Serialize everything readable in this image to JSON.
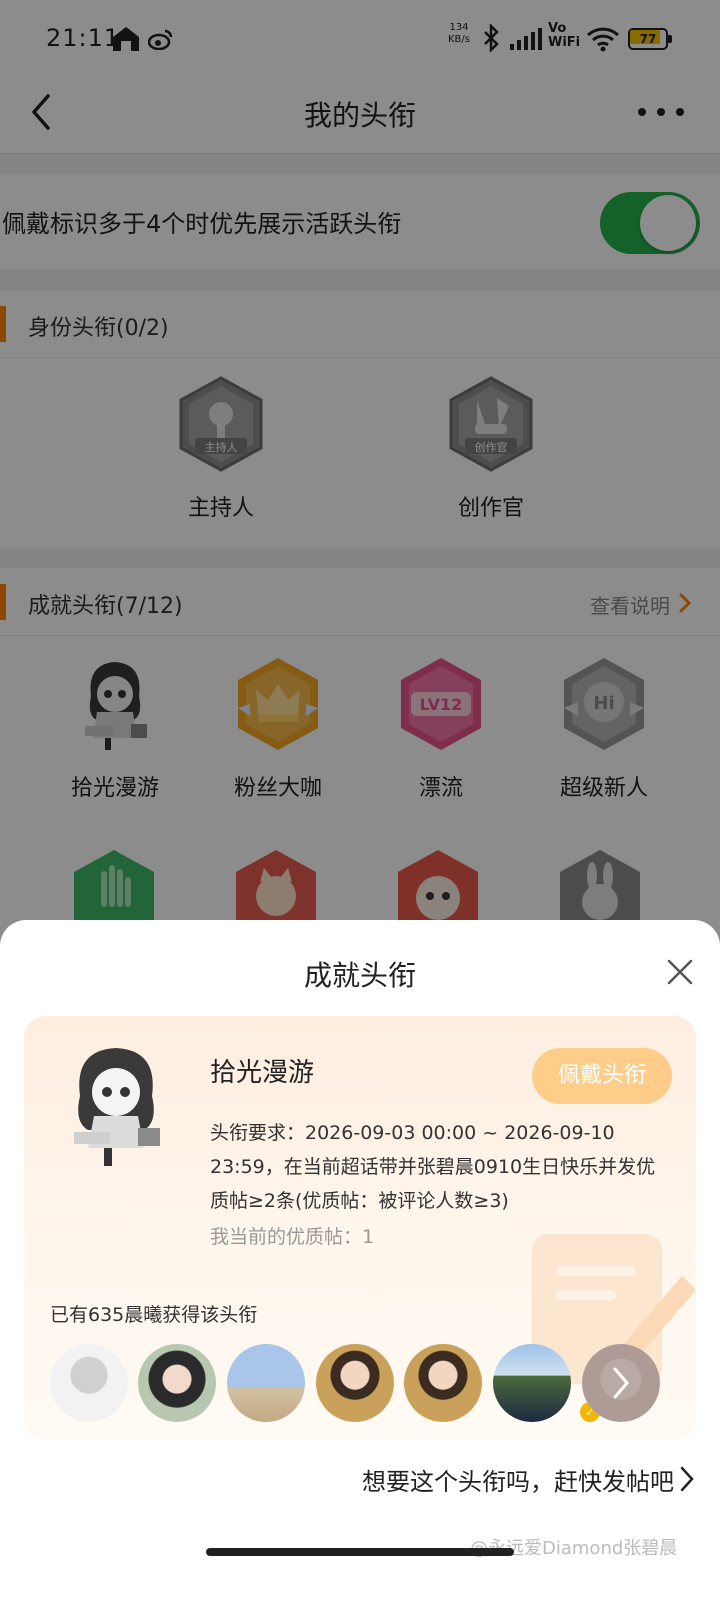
{
  "status_bar": {
    "time": "21:11",
    "net_speed_value": "134",
    "net_speed_unit": "KB/s",
    "vo": "Vo",
    "wifi_label": "WiFi",
    "battery": "77",
    "icons": [
      "home-icon",
      "weibo-icon",
      "bluetooth-icon",
      "signal-icon",
      "wifi-icon",
      "battery-icon"
    ]
  },
  "nav": {
    "title": "我的头衔",
    "icons": [
      "back-icon",
      "more-icon"
    ]
  },
  "setting": {
    "label": "佩戴标识多于4个时优先展示活跃头衔",
    "toggle_on": true,
    "toggle_color": "#26b14c"
  },
  "identity_section": {
    "title": "身份头衔(0/2)",
    "badges": [
      {
        "name": "主持人",
        "badge_text": "主持人"
      },
      {
        "name": "创作官",
        "badge_text": "创作官"
      }
    ]
  },
  "achievement_section": {
    "title": "成就头衔(7/12)",
    "link": "查看说明",
    "badges": [
      {
        "name": "拾光漫游"
      },
      {
        "name": "粉丝大咖"
      },
      {
        "name": "漂流",
        "badge_text": "LV12"
      },
      {
        "name": "超级新人",
        "badge_text": "Hi"
      }
    ]
  },
  "sheet": {
    "title": "成就头衔",
    "badge_name": "拾光漫游",
    "wear_button": "佩戴头衔",
    "requirement": "头衔要求：2026-09-03 00:00 ~ 2026-09-10 23:59，在当前超话带并张碧晨0910生日快乐并发优质帖≥2条(优质帖：被评论人数≥3)",
    "current": "我当前的优质帖：1",
    "owners": "已有635晨曦获得该头衔",
    "cta": "想要这个头衔吗，赶快发帖吧",
    "watermark": "@永远爱Diamond张碧晨",
    "accent": "#ff8200"
  }
}
